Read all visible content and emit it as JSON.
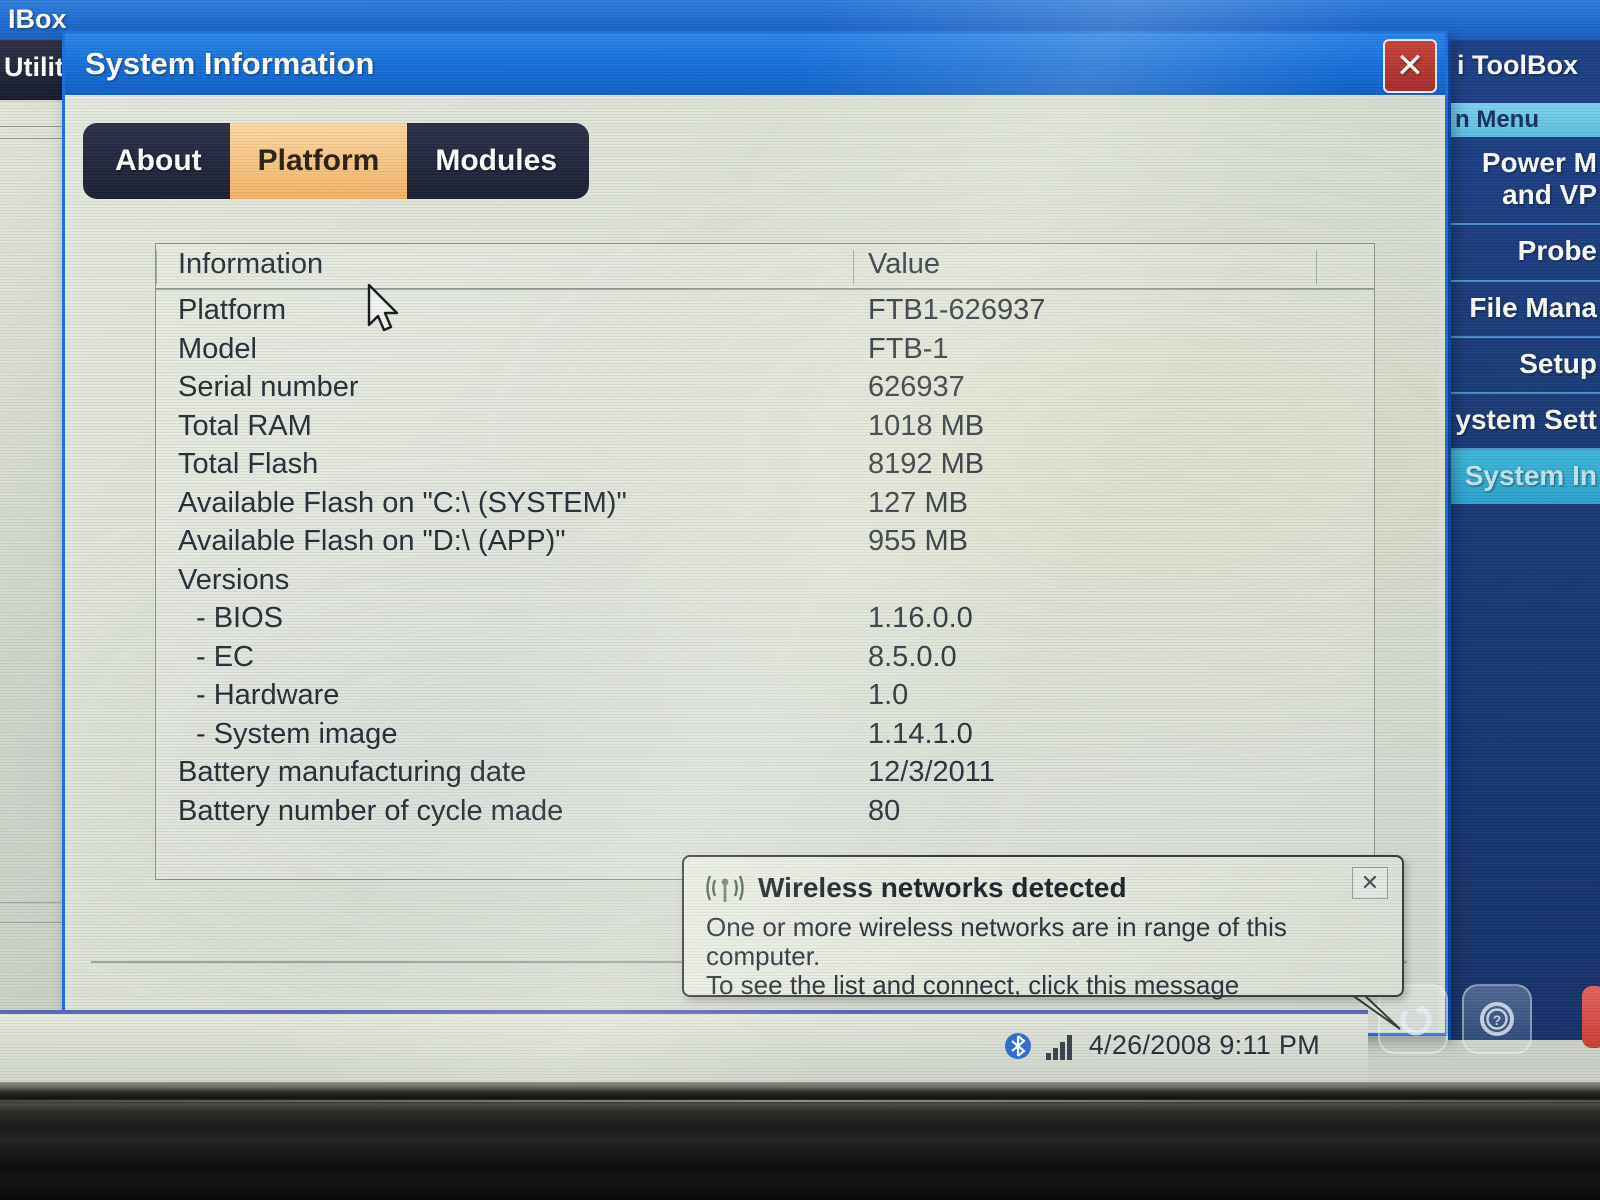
{
  "background_window": {
    "title": "IBox",
    "menu_label": "Utilit",
    "sidebar": {
      "brand": "i ToolBox",
      "current_label": "n Menu",
      "items": [
        {
          "label": "Power M\nand VP",
          "highlighted": false
        },
        {
          "label": "Probe",
          "highlighted": false
        },
        {
          "label": "File Mana",
          "highlighted": false
        },
        {
          "label": "Setup",
          "highlighted": false
        },
        {
          "label": "ystem Sett",
          "highlighted": false
        },
        {
          "label": "System In",
          "highlighted": true
        }
      ]
    },
    "buttons": [
      {
        "name": "back-button",
        "icon": "back-arrow-icon"
      },
      {
        "name": "help-button",
        "icon": "question-mark-icon"
      }
    ]
  },
  "taskbar": {
    "bluetooth_icon": "bluetooth-icon",
    "signal_icon": "signal-bars-icon",
    "datetime": "4/26/2008 9:11 PM"
  },
  "dialog": {
    "title": "System Information",
    "close_label": "✕",
    "tabs": [
      {
        "label": "About",
        "active": false
      },
      {
        "label": "Platform",
        "active": true
      },
      {
        "label": "Modules",
        "active": false
      }
    ],
    "table": {
      "headers": [
        "Information",
        "Value"
      ],
      "rows": [
        {
          "key": "Platform",
          "value": "FTB1-626937",
          "indent": false
        },
        {
          "key": "Model",
          "value": "FTB-1",
          "indent": false
        },
        {
          "key": "Serial number",
          "value": "626937",
          "indent": false
        },
        {
          "key": "Total RAM",
          "value": "1018 MB",
          "indent": false
        },
        {
          "key": "Total Flash",
          "value": "8192 MB",
          "indent": false
        },
        {
          "key": "Available Flash on \"C:\\ (SYSTEM)\"",
          "value": "127 MB",
          "indent": false
        },
        {
          "key": "Available Flash on \"D:\\ (APP)\"",
          "value": "955 MB",
          "indent": false
        },
        {
          "key": "Versions",
          "value": "",
          "indent": false
        },
        {
          "key": "- BIOS",
          "value": "1.16.0.0",
          "indent": true
        },
        {
          "key": "- EC",
          "value": "8.5.0.0",
          "indent": true
        },
        {
          "key": "- Hardware",
          "value": "1.0",
          "indent": true
        },
        {
          "key": "- System image",
          "value": "1.14.1.0",
          "indent": true
        },
        {
          "key": "Battery manufacturing date",
          "value": "12/3/2011",
          "indent": false
        },
        {
          "key": "Battery number of cycle made",
          "value": "80",
          "indent": false
        }
      ]
    }
  },
  "notification": {
    "icon": "wireless-signal-icon",
    "title": "Wireless networks detected",
    "line1": "One or more wireless networks are in range of this computer.",
    "line2": "To see the list and connect, click this message",
    "close_label": "✕"
  },
  "colors": {
    "title_blue": "#1570dc",
    "sidebar_blue": "#173874",
    "accent_orange": "#f3b468",
    "close_red": "#a52d26",
    "highlight_cyan": "#5cc0e6"
  }
}
